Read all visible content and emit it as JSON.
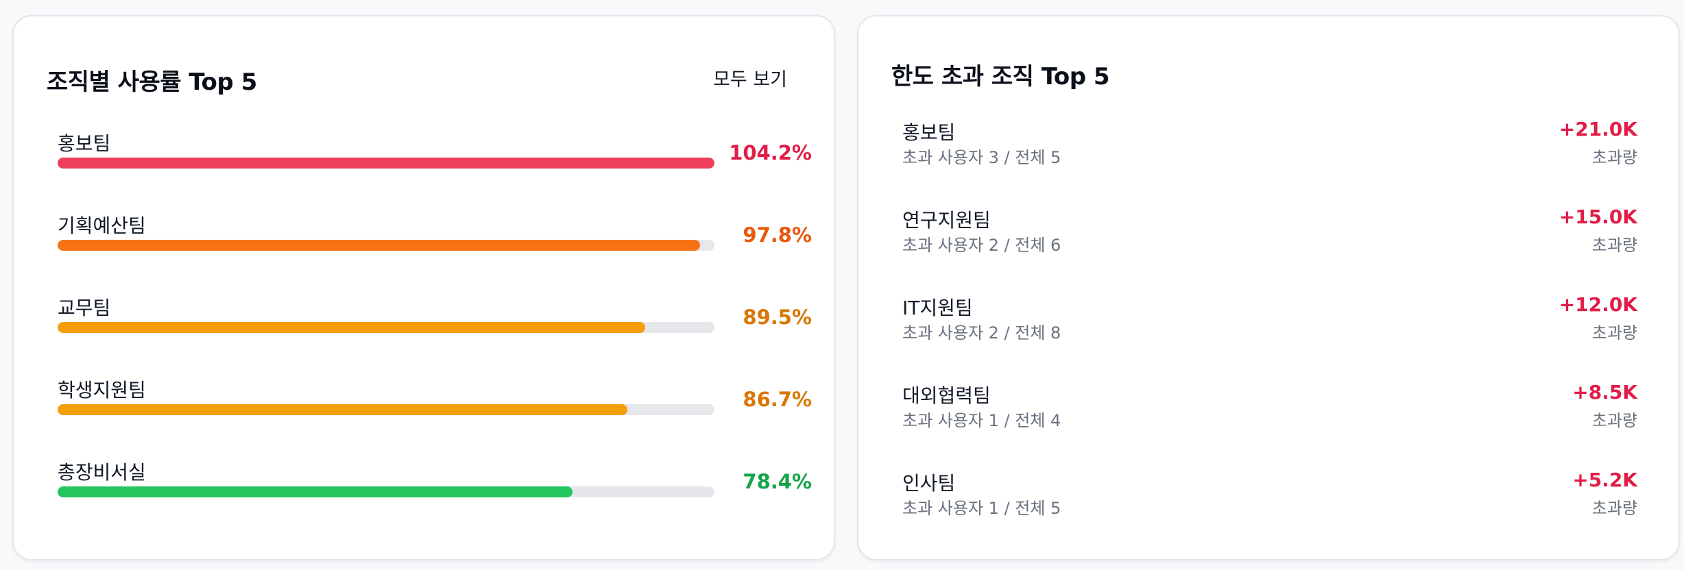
{
  "usage": {
    "title": "조직별 사용률 Top 5",
    "view_all_label": "모두 보기",
    "items": [
      {
        "name": "홍보팀",
        "percent_label": "104.2%",
        "value": 104.2,
        "color": "#ef3e5c",
        "text_color": "#e11d48"
      },
      {
        "name": "기획예산팀",
        "percent_label": "97.8%",
        "value": 97.8,
        "color": "#f97316",
        "text_color": "#ea580c"
      },
      {
        "name": "교무팀",
        "percent_label": "89.5%",
        "value": 89.5,
        "color": "#f59e0b",
        "text_color": "#d97706"
      },
      {
        "name": "학생지원팀",
        "percent_label": "86.7%",
        "value": 86.7,
        "color": "#f59e0b",
        "text_color": "#d97706"
      },
      {
        "name": "총장비서실",
        "percent_label": "78.4%",
        "value": 78.4,
        "color": "#22c55e",
        "text_color": "#16a34a"
      }
    ]
  },
  "overage": {
    "title": "한도 초과 조직 Top 5",
    "items": [
      {
        "name": "홍보팀",
        "detail": "초과 사용자 3 / 전체 5",
        "amount": "+21.0K",
        "amount_label": "초과량"
      },
      {
        "name": "연구지원팀",
        "detail": "초과 사용자 2 / 전체 6",
        "amount": "+15.0K",
        "amount_label": "초과량"
      },
      {
        "name": "IT지원팀",
        "detail": "초과 사용자 2 / 전체 8",
        "amount": "+12.0K",
        "amount_label": "초과량"
      },
      {
        "name": "대외협력팀",
        "detail": "초과 사용자 1 / 전체 4",
        "amount": "+8.5K",
        "amount_label": "초과량"
      },
      {
        "name": "인사팀",
        "detail": "초과 사용자 1 / 전체 5",
        "amount": "+5.2K",
        "amount_label": "초과량"
      }
    ]
  }
}
